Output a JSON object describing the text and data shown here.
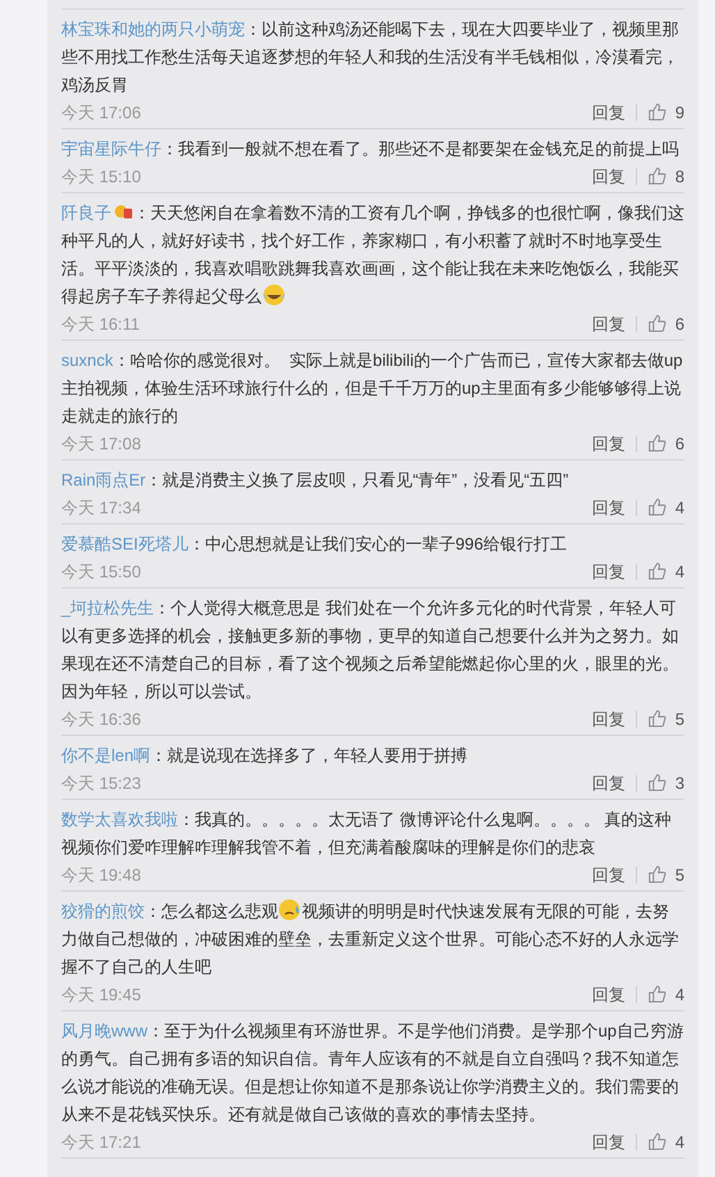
{
  "comments": [
    {
      "user": "林宝珠和她的两只小萌宠",
      "badge": false,
      "separator": "：",
      "segments": [
        {
          "kind": "text",
          "text": "以前这种鸡汤还能喝下去，现在大四要毕业了，视频里那些不用找工作愁生活每天追逐梦想的年轻人和我的生活没有半毛钱相似，冷漠看完，鸡汤反胃"
        }
      ],
      "time": "今天 17:06",
      "reply": "回复",
      "likes": "9"
    },
    {
      "user": "宇宙星际牛仔",
      "badge": false,
      "separator": "：",
      "segments": [
        {
          "kind": "text",
          "text": "我看到一般就不想在看了。那些还不是都要架在金钱充足的前提上吗"
        }
      ],
      "time": "今天 15:10",
      "reply": "回复",
      "likes": "8"
    },
    {
      "user": "阡良子",
      "badge": true,
      "separator": "：",
      "segments": [
        {
          "kind": "text",
          "text": "天天悠闲自在拿着数不清的工资有几个啊，挣钱多的也很忙啊，像我们这种平凡的人，就好好读书，找个好工作，养家糊口，有小积蓄了就时不时地享受生活。平平淡淡的，我喜欢唱歌跳舞我喜欢画画，这个能让我在未来吃饱饭么，我能买得起房子车子养得起父母么"
        },
        {
          "kind": "laugh-emoji"
        }
      ],
      "time": "今天 16:11",
      "reply": "回复",
      "likes": "6"
    },
    {
      "user": "suxnck",
      "badge": false,
      "separator": "：",
      "segments": [
        {
          "kind": "text",
          "text": "哈哈你的感觉很对。  实际上就是bilibili的一个广告而已，宣传大家都去做up主拍视频，体验生活环球旅行什么的，但是千千万万的up主里面有多少能够够得上说走就走的旅行的"
        }
      ],
      "time": "今天 17:08",
      "reply": "回复",
      "likes": "6"
    },
    {
      "user": "Rain雨点Er",
      "badge": false,
      "separator": "：",
      "segments": [
        {
          "kind": "text",
          "text": "就是消费主义换了层皮呗，只看见“青年”，没看见“五四”"
        }
      ],
      "time": "今天 17:34",
      "reply": "回复",
      "likes": "4"
    },
    {
      "user": "爱慕酷SEI死塔儿",
      "badge": false,
      "separator": "：",
      "segments": [
        {
          "kind": "text",
          "text": "中心思想就是让我们安心的一辈子996给银行打工"
        }
      ],
      "time": "今天 15:50",
      "reply": "回复",
      "likes": "4"
    },
    {
      "user": "_坷拉松先生",
      "badge": false,
      "separator": "：",
      "segments": [
        {
          "kind": "text",
          "text": "个人觉得大概意思是 我们处在一个允许多元化的时代背景，年轻人可以有更多选择的机会，接触更多新的事物，更早的知道自己想要什么并为之努力。如果现在还不清楚自己的目标，看了这个视频之后希望能燃起你心里的火，眼里的光。因为年轻，所以可以尝试。"
        }
      ],
      "time": "今天 16:36",
      "reply": "回复",
      "likes": "5"
    },
    {
      "user": "你不是len啊",
      "badge": false,
      "separator": "：",
      "segments": [
        {
          "kind": "text",
          "text": "就是说现在选择多了，年轻人要用于拼搏"
        }
      ],
      "time": "今天 15:23",
      "reply": "回复",
      "likes": "3"
    },
    {
      "user": "数学太喜欢我啦",
      "badge": false,
      "separator": "：",
      "segments": [
        {
          "kind": "text",
          "text": "我真的。。。。。太无语了 微博评论什么鬼啊。。。。 真的这种视频你们爱咋理解咋理解我管不着，但充满着酸腐味的理解是你们的悲哀"
        }
      ],
      "time": "今天 19:48",
      "reply": "回复",
      "likes": "5"
    },
    {
      "user": "狡猾的煎饺",
      "badge": false,
      "separator": "：",
      "segments": [
        {
          "kind": "text",
          "text": "怎么都这么悲观"
        },
        {
          "kind": "sweat-emoji"
        },
        {
          "kind": "text",
          "text": "视频讲的明明是时代快速发展有无限的可能，去努力做自己想做的，冲破困难的壁垒，去重新定义这个世界。可能心态不好的人永远学握不了自己的人生吧"
        }
      ],
      "time": "今天 19:45",
      "reply": "回复",
      "likes": "4"
    },
    {
      "user": "风月晚www",
      "badge": false,
      "separator": "：",
      "segments": [
        {
          "kind": "text",
          "text": "至于为什么视频里有环游世界。不是学他们消费。是学那个up自己穷游的勇气。自己拥有多语的知识自信。青年人应该有的不就是自立自强吗？我不知道怎么说才能说的准确无误。但是想让你知道不是那条说让你学消费主义的。我们需要的从来不是花钱买快乐。还有就是做自己该做的喜欢的事情去坚持。"
        }
      ],
      "time": "今天 17:21",
      "reply": "回复",
      "likes": "4"
    }
  ]
}
